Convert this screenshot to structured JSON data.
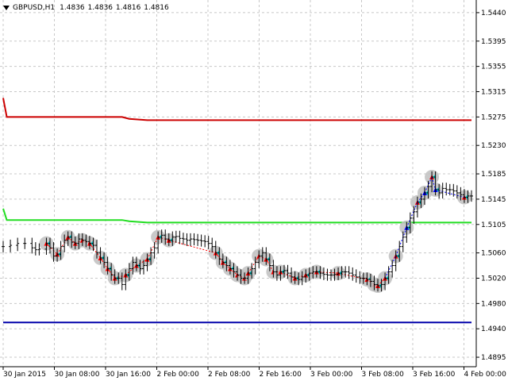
{
  "header": {
    "symbol": "GBPUSD,H1",
    "ohlc": "1.4836 1.4836 1.4816 1.4816"
  },
  "price_axis": {
    "ticks": [
      "1.5440",
      "1.5395",
      "1.5355",
      "1.5315",
      "1.5275",
      "1.5230",
      "1.5185",
      "1.5145",
      "1.5105",
      "1.5060",
      "1.5020",
      "1.4980",
      "1.4940",
      "1.4895"
    ]
  },
  "time_axis": {
    "ticks": [
      "30 Jan 2015",
      "30 Jan 08:00",
      "30 Jan 16:00",
      "2 Feb 00:00",
      "2 Feb 08:00",
      "2 Feb 16:00",
      "3 Feb 00:00",
      "3 Feb 08:00",
      "3 Feb 16:00",
      "4 Feb 00:00"
    ]
  },
  "colors": {
    "background": "#ffffff",
    "grid": "#c8c8c8",
    "candle": "#000000",
    "upper_level": "#cc0000",
    "middle_level": "#22dd22",
    "lower_level": "#0000aa",
    "signal_circle": "#c0c0c0",
    "marker_red": "#ff0000",
    "marker_blue": "#0000ff",
    "marker_cyan": "#00cccc"
  },
  "chart_data": {
    "type": "line",
    "title": "GBPUSD,H1",
    "x_range": [
      "30 Jan 2015 00:00",
      "4 Feb 2015 01:00"
    ],
    "ylim": [
      1.488,
      1.546
    ],
    "grid": true,
    "series": [
      {
        "values": [
          [
            0,
            1.507
          ],
          [
            2,
            1.5072
          ],
          [
            4,
            1.5075
          ],
          [
            6,
            1.5075
          ],
          [
            8,
            1.5068
          ],
          [
            9,
            1.5065
          ],
          [
            10,
            1.5066
          ],
          [
            12,
            1.5075
          ],
          [
            13,
            1.5068
          ],
          [
            14,
            1.5055
          ],
          [
            15,
            1.5058
          ],
          [
            16,
            1.507
          ],
          [
            17,
            1.508
          ],
          [
            18,
            1.5085
          ],
          [
            19,
            1.5077
          ],
          [
            20,
            1.5075
          ],
          [
            21,
            1.5082
          ],
          [
            22,
            1.508
          ],
          [
            23,
            1.5078
          ],
          [
            24,
            1.5075
          ],
          [
            25,
            1.5072
          ],
          [
            26,
            1.506
          ],
          [
            27,
            1.5052
          ],
          [
            28,
            1.5045
          ],
          [
            29,
            1.5035
          ],
          [
            30,
            1.5025
          ],
          [
            31,
            1.502
          ],
          [
            32,
            1.502
          ],
          [
            33,
            1.501
          ],
          [
            34,
            1.5025
          ],
          [
            35,
            1.5035
          ],
          [
            36,
            1.5045
          ],
          [
            37,
            1.504
          ],
          [
            38,
            1.5035
          ],
          [
            39,
            1.504
          ],
          [
            40,
            1.505
          ],
          [
            41,
            1.506
          ],
          [
            42,
            1.5068
          ],
          [
            43,
            1.5085
          ],
          [
            44,
            1.5088
          ],
          [
            45,
            1.5082
          ],
          [
            46,
            1.508
          ],
          [
            47,
            1.5085
          ],
          [
            48,
            1.5086
          ],
          [
            49,
            1.5083
          ],
          [
            50,
            1.5082
          ],
          [
            51,
            1.508
          ],
          [
            52,
            1.5082
          ],
          [
            53,
            1.5081
          ],
          [
            54,
            1.508
          ],
          [
            55,
            1.5079
          ],
          [
            56,
            1.5078
          ],
          [
            57,
            1.5075
          ],
          [
            58,
            1.507
          ],
          [
            59,
            1.506
          ],
          [
            60,
            1.505
          ],
          [
            61,
            1.5045
          ],
          [
            62,
            1.504
          ],
          [
            63,
            1.5035
          ],
          [
            64,
            1.503
          ],
          [
            65,
            1.5025
          ],
          [
            66,
            1.502
          ],
          [
            67,
            1.502
          ],
          [
            68,
            1.5028
          ],
          [
            69,
            1.5035
          ],
          [
            70,
            1.5045
          ],
          [
            71,
            1.5055
          ],
          [
            72,
            1.506
          ],
          [
            73,
            1.505
          ],
          [
            74,
            1.504
          ],
          [
            75,
            1.503
          ],
          [
            76,
            1.5025
          ],
          [
            77,
            1.503
          ],
          [
            78,
            1.5032
          ],
          [
            79,
            1.5028
          ],
          [
            80,
            1.5022
          ],
          [
            81,
            1.502
          ],
          [
            82,
            1.5018
          ],
          [
            83,
            1.5022
          ],
          [
            84,
            1.5025
          ],
          [
            85,
            1.5028
          ],
          [
            86,
            1.503
          ],
          [
            87,
            1.503
          ],
          [
            88,
            1.5028
          ],
          [
            89,
            1.5026
          ],
          [
            90,
            1.5025
          ],
          [
            91,
            1.5025
          ],
          [
            92,
            1.5026
          ],
          [
            93,
            1.5028
          ],
          [
            94,
            1.503
          ],
          [
            95,
            1.503
          ],
          [
            96,
            1.5028
          ],
          [
            97,
            1.5025
          ],
          [
            98,
            1.5022
          ],
          [
            99,
            1.502
          ],
          [
            100,
            1.502
          ],
          [
            101,
            1.5018
          ],
          [
            102,
            1.5015
          ],
          [
            103,
            1.501
          ],
          [
            104,
            1.5008
          ],
          [
            105,
            1.501
          ],
          [
            106,
            1.502
          ],
          [
            107,
            1.503
          ],
          [
            108,
            1.504
          ],
          [
            109,
            1.5055
          ],
          [
            110,
            1.507
          ],
          [
            111,
            1.5085
          ],
          [
            112,
            1.51
          ],
          [
            113,
            1.5115
          ],
          [
            114,
            1.5125
          ],
          [
            115,
            1.514
          ],
          [
            116,
            1.5145
          ],
          [
            117,
            1.5155
          ],
          [
            118,
            1.5165
          ],
          [
            119,
            1.518
          ],
          [
            120,
            1.516
          ],
          [
            121,
            1.5155
          ],
          [
            122,
            1.5162
          ],
          [
            123,
            1.516
          ],
          [
            124,
            1.516
          ],
          [
            125,
            1.5158
          ],
          [
            126,
            1.5155
          ],
          [
            127,
            1.5152
          ],
          [
            128,
            1.5148
          ],
          [
            129,
            1.515
          ],
          [
            130,
            1.515
          ]
        ]
      },
      {
        "values": [
          [
            0,
            1.5305
          ],
          [
            1,
            1.5275
          ],
          [
            33,
            1.5275
          ],
          [
            35,
            1.5272
          ],
          [
            40,
            1.527
          ],
          [
            130,
            1.527
          ]
        ]
      },
      {
        "values": [
          [
            0,
            1.513
          ],
          [
            1,
            1.5112
          ],
          [
            33,
            1.5112
          ],
          [
            35,
            1.511
          ],
          [
            40,
            1.5108
          ],
          [
            130,
            1.5108
          ]
        ]
      },
      {
        "values": [
          [
            0,
            1.495
          ],
          [
            130,
            1.495
          ]
        ]
      }
    ]
  }
}
